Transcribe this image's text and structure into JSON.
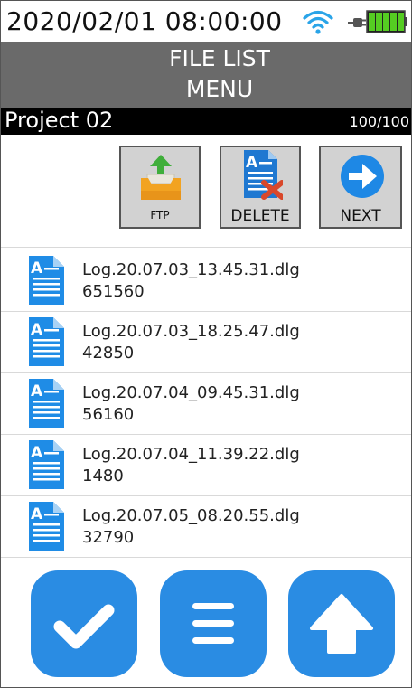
{
  "status": {
    "datetime": "2020/02/01 08:00:00",
    "icons": [
      "wifi-icon",
      "plug-icon",
      "battery-full-icon"
    ]
  },
  "header": {
    "title_line1": "FILE LIST",
    "title_line2": "MENU"
  },
  "project": {
    "name": "Project 02",
    "count": "100/100"
  },
  "toolbar": {
    "ftp_label": "FTP",
    "delete_label": "DELETE",
    "next_label": "NEXT"
  },
  "files": [
    {
      "name": "Log.20.07.03_13.45.31.dlg",
      "size": "651560"
    },
    {
      "name": "Log.20.07.03_18.25.47.dlg",
      "size": "42850"
    },
    {
      "name": "Log.20.07.04_09.45.31.dlg",
      "size": "56160"
    },
    {
      "name": "Log.20.07.04_11.39.22.dlg",
      "size": "1480"
    },
    {
      "name": "Log.20.07.05_08.20.55.dlg",
      "size": "32790"
    }
  ],
  "bottom_buttons": [
    "check-icon",
    "menu-icon",
    "up-arrow-icon"
  ],
  "colors": {
    "accent": "#2a8ce3",
    "title_bar": "#6a6a6a",
    "battery": "#55cc22"
  }
}
